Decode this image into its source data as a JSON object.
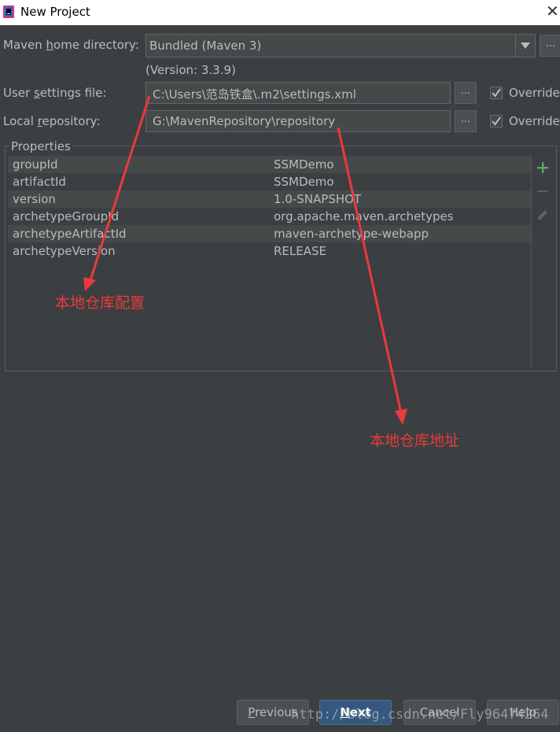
{
  "window": {
    "title": "New Project",
    "close_symbol": "✕"
  },
  "maven": {
    "home_label_pre": "Maven ",
    "home_label_u": "h",
    "home_label_post": "ome directory:",
    "home_value": "Bundled (Maven 3)",
    "version_text": "(Version: 3.3.9)",
    "browse_label": "...",
    "settings_label_pre": "User ",
    "settings_label_u": "s",
    "settings_label_post": "ettings file:",
    "settings_value": "C:\\Users\\范岛铁盒\\.m2\\settings.xml",
    "settings_override": "Override",
    "repo_label_pre": "Local ",
    "repo_label_u": "r",
    "repo_label_post": "epository:",
    "repo_value": "G:\\MavenRepository\\repository",
    "repo_override": "Override"
  },
  "properties": {
    "title": "Properties",
    "rows": [
      {
        "key": "groupId",
        "value": "SSMDemo"
      },
      {
        "key": "artifactId",
        "value": "SSMDemo"
      },
      {
        "key": "version",
        "value": "1.0-SNAPSHOT"
      },
      {
        "key": "archetypeGroupId",
        "value": "org.apache.maven.archetypes"
      },
      {
        "key": "archetypeArtifactId",
        "value": "maven-archetype-webapp"
      },
      {
        "key": "archetypeVersion",
        "value": "RELEASE"
      }
    ]
  },
  "annotations": {
    "config_note": "本地仓库配置",
    "address_note": "本地仓库地址"
  },
  "buttons": {
    "previous_pre": "",
    "previous_u": "P",
    "previous_post": "revious",
    "next_pre": "",
    "next_u": "N",
    "next_post": "ext",
    "cancel": "Cancel",
    "help": "Help"
  },
  "watermark": "http://blog.csdn.net/Fly96474264",
  "colors": {
    "background": "#3c3f41",
    "annotation": "#e83b3b",
    "primary_button": "#365880",
    "add_icon": "#59a869"
  }
}
